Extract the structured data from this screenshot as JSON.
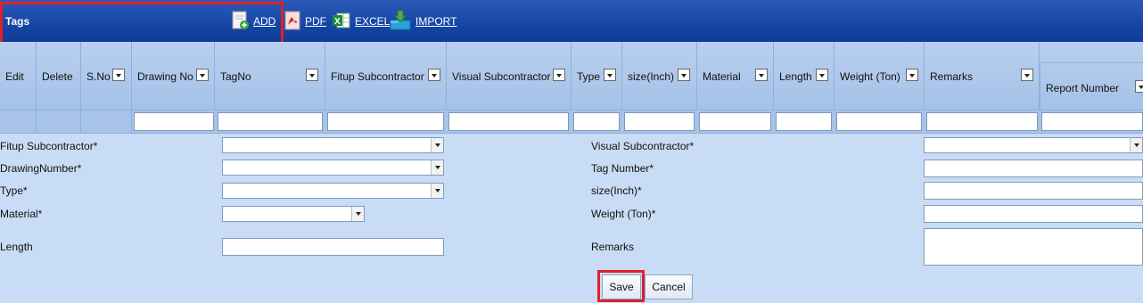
{
  "toolbar": {
    "title": "Tags",
    "add_label": "ADD",
    "pdf_label": "PDF",
    "excel_label": "EXCEL",
    "import_label": "IMPORT",
    "highlight_color": "#e0202a",
    "bar_color": "#1546a6"
  },
  "grid": {
    "columns": {
      "edit": "Edit",
      "delete": "Delete",
      "sno": "S.No",
      "drawing_no": "Drawing No",
      "tag_no": "TagNo",
      "fitup_sub": "Fitup Subcontractor",
      "visual_sub": "Visual Subcontractor",
      "type": "Type",
      "size": "size(Inch)",
      "material": "Material",
      "length": "Length",
      "weight": "Weight (Ton)",
      "remarks": "Remarks",
      "report_number": "Report Number"
    }
  },
  "form": {
    "fitup_sub_label": "Fitup Subcontractor*",
    "drawing_number_label": "DrawingNumber*",
    "type_label": "Type*",
    "material_label": "Material*",
    "length_label": "Length",
    "visual_sub_label": "Visual Subcontractor*",
    "tag_number_label": "Tag Number*",
    "size_label": "size(Inch)*",
    "weight_label": "Weight (Ton)*",
    "remarks_label": "Remarks",
    "save_label": "Save",
    "cancel_label": "Cancel"
  }
}
